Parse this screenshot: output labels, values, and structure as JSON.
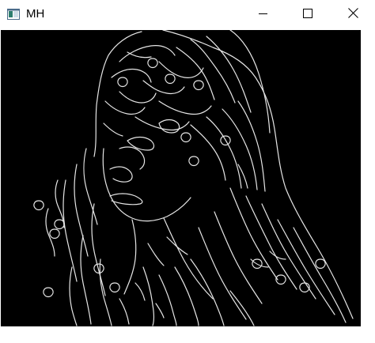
{
  "window": {
    "title": "MH",
    "icon": "app-window-icon",
    "controls": {
      "minimize_icon": "minimize-icon",
      "maximize_icon": "maximize-icon",
      "close_icon": "close-icon"
    }
  },
  "image": {
    "content": "edge-detection-output",
    "background_color": "#000000",
    "edge_color": "#e6e6e6"
  }
}
